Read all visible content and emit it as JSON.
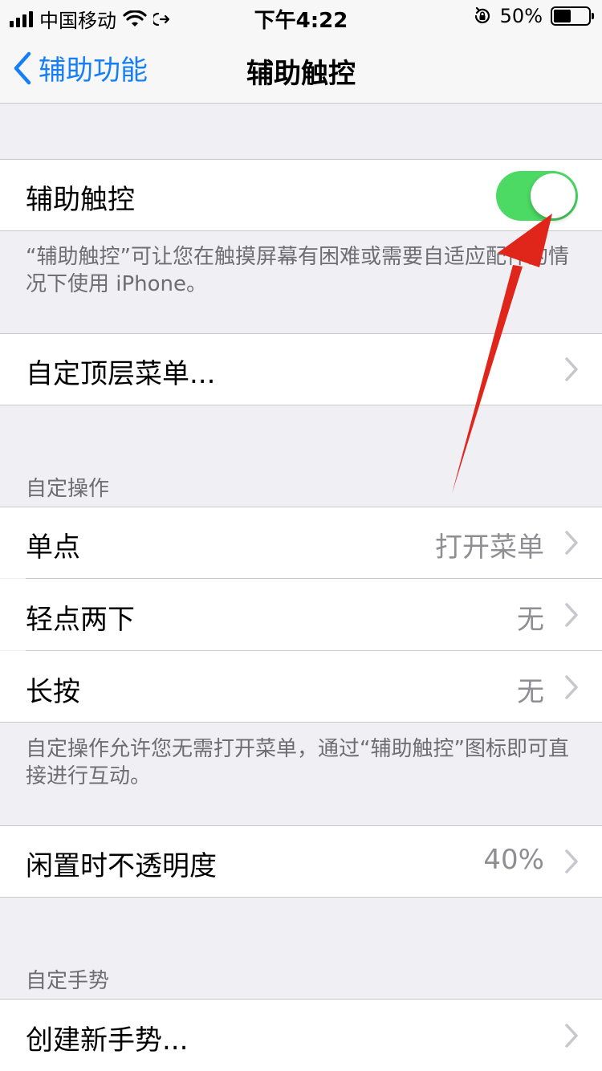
{
  "status_bar": {
    "carrier": "中国移动",
    "time": "下午4:22",
    "battery_percent": "50%",
    "battery_level": 0.5
  },
  "nav": {
    "back_label": "辅助功能",
    "title": "辅助触控"
  },
  "toggle_row": {
    "label": "辅助触控",
    "on": true,
    "on_color": "#4cd964",
    "footer": "“辅助触控”可让您在触摸屏幕有困难或需要自适应配件的情况下使用 iPhone。"
  },
  "top_menu": {
    "label": "自定顶层菜单..."
  },
  "custom_actions": {
    "header": "自定操作",
    "rows": [
      {
        "label": "单点",
        "value": "打开菜单"
      },
      {
        "label": "轻点两下",
        "value": "无"
      },
      {
        "label": "长按",
        "value": "无"
      }
    ],
    "footer": "自定操作允许您无需打开菜单，通过“辅助触控”图标即可直接进行互动。"
  },
  "idle_opacity": {
    "label": "闲置时不透明度",
    "value": "40%"
  },
  "custom_gestures": {
    "header": "自定手势",
    "create_label": "创建新手势..."
  },
  "colors": {
    "accent": "#147efb",
    "annotation_arrow": "#e0251b"
  }
}
